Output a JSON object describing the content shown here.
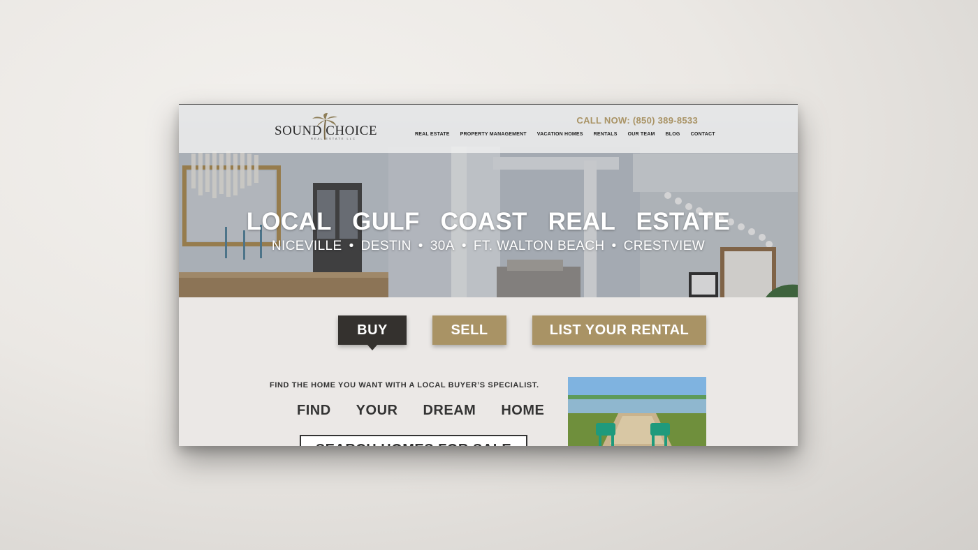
{
  "header": {
    "logo_text": "SOUND CHOICE",
    "logo_subtext": "REAL ESTATE LLC",
    "call_now": "CALL NOW: (850) 389-8533",
    "nav": [
      "REAL ESTATE",
      "PROPERTY MANAGEMENT",
      "VACATION HOMES",
      "RENTALS",
      "OUR TEAM",
      "BLOG",
      "CONTACT"
    ]
  },
  "hero": {
    "title": "LOCAL GULF COAST REAL ESTATE",
    "locations": [
      "NICEVILLE",
      "DESTIN",
      "30A",
      "FT. WALTON BEACH",
      "CRESTVIEW"
    ],
    "separator": "•"
  },
  "actions": {
    "buy": "BUY",
    "sell": "SELL",
    "list_rental": "LIST YOUR RENTAL"
  },
  "buy_section": {
    "tagline": "FIND THE HOME YOU WANT WITH A LOCAL BUYER’S SPECIALIST.",
    "dream_words": [
      "FIND",
      "YOUR",
      "DREAM",
      "HOME"
    ],
    "search_button": "SEARCH HOMES FOR SALE"
  },
  "colors": {
    "gold": "#a99365",
    "dark": "#34312e"
  }
}
